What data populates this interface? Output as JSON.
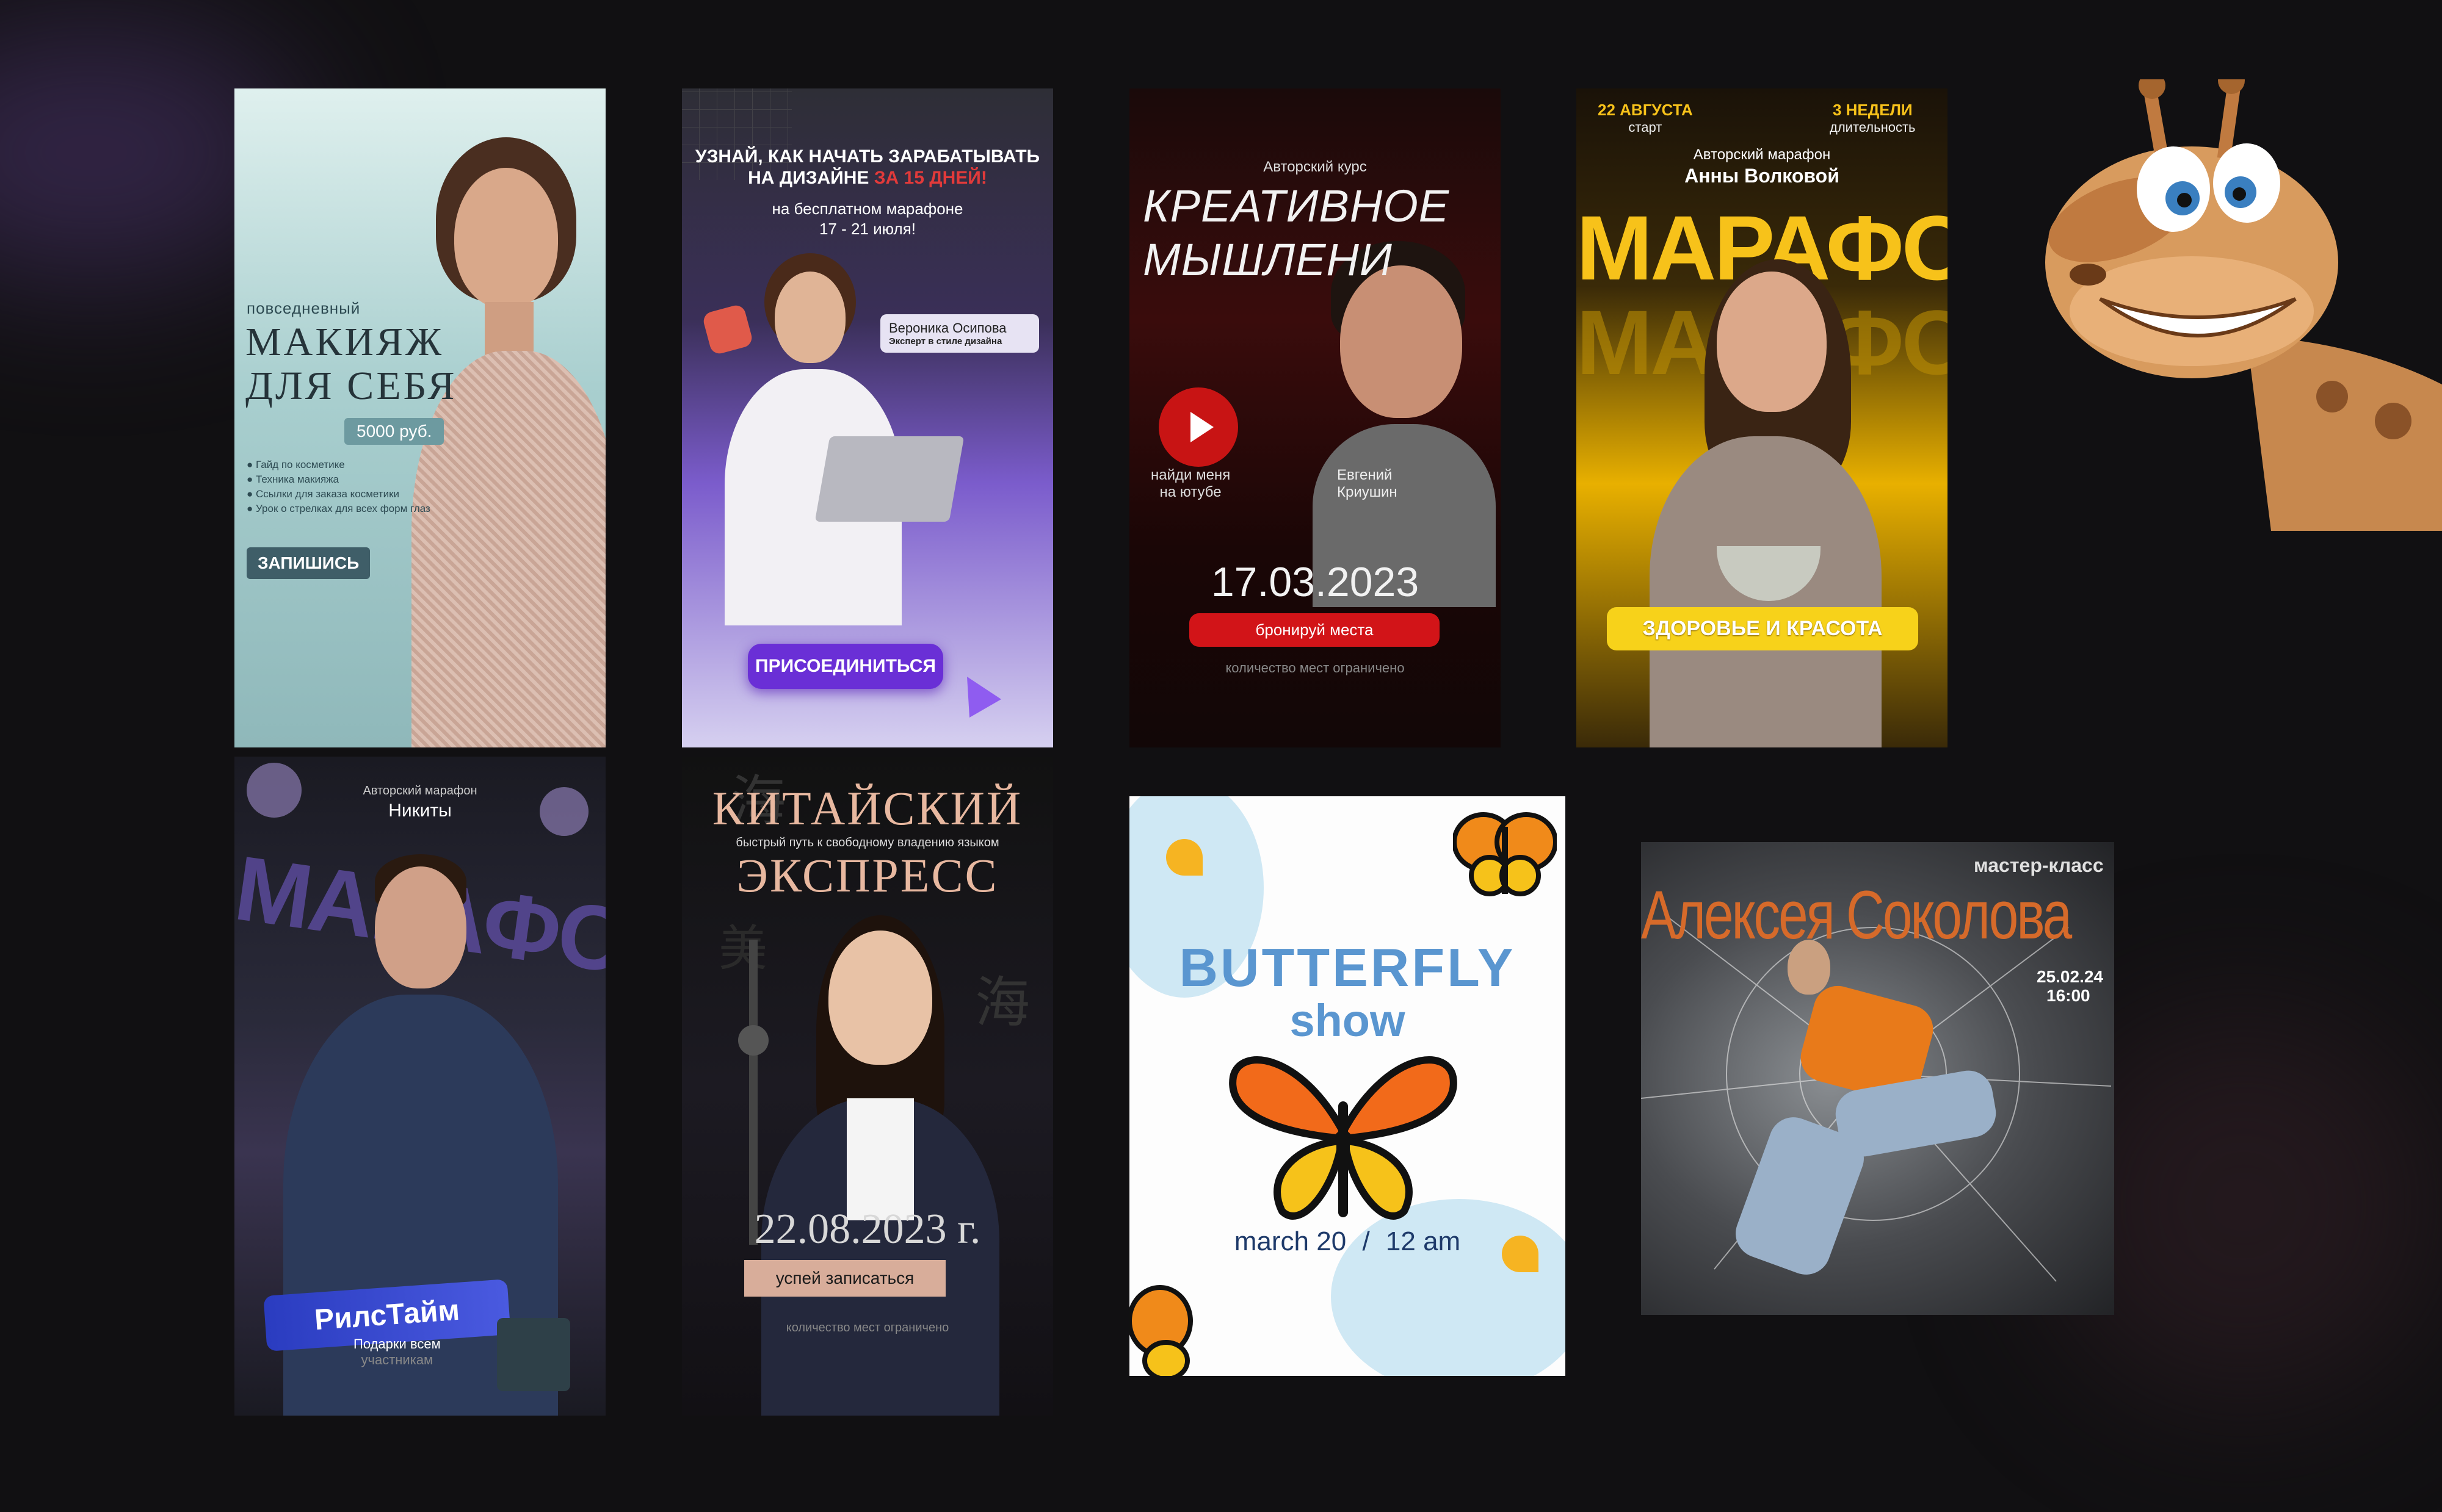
{
  "colors": {
    "background": "#111012",
    "accent_purple": "#6a2fd6",
    "accent_red": "#d21418",
    "accent_yellow": "#f7c21a"
  },
  "card1": {
    "subtitle": "повседневный",
    "title_line1": "МАКИЯЖ",
    "title_line2": "ДЛЯ СЕБЯ",
    "price": "5000 руб.",
    "bullets": [
      "Гайд по косметике",
      "Техника макияжа",
      "Ссылки для заказа косметики",
      "Урок о стрелках для всех форм глаз"
    ],
    "cta": "ЗАПИШИСЬ"
  },
  "card2": {
    "headline1": "УЗНАЙ, КАК НАЧАТЬ ЗАРАБАТЫВАТЬ",
    "headline2a": "НА ДИЗАЙНЕ",
    "headline2b": "ЗА 15 ДНЕЙ!",
    "line3": "на бесплатном марафоне",
    "line4": "17 - 21 июля!",
    "expert_name": "Вероника Осипова",
    "expert_role": "Эксперт в стиле дизайна",
    "cta": "ПРИСОЕДИНИТЬСЯ"
  },
  "card3": {
    "kicker": "Авторский курс",
    "title1": "КРЕАТИВНОЕ",
    "title2": "МЫШЛЕНИ",
    "youtube1": "найди меня",
    "youtube2": "на ютубе",
    "author1": "Евгений",
    "author2": "Криушин",
    "date": "17.03.2023",
    "cta": "бронируй места",
    "note": "количество мест ограничено"
  },
  "card4": {
    "date_top": "22 АВГУСТА",
    "date_sub": "старт",
    "dur_top": "3 НЕДЕЛИ",
    "dur_sub": "длительность",
    "kicker": "Авторский марафон",
    "author": "Анны Волковой",
    "big": "МАРАФОН",
    "badge": "ЗДОРОВЬЕ И КРАСОТА"
  },
  "card5": {
    "kicker": "Авторский марафон",
    "author": "Никиты",
    "big": "МАРАФОН",
    "badge": "РилсТайм",
    "gift1": "Подарки всем",
    "gift2": "участникам"
  },
  "card6": {
    "title1": "КИТАЙСКИЙ",
    "subtitle": "быстрый путь к свободному владению языком",
    "title2": "ЭКСПРЕСС",
    "date": "22.08.2023 г.",
    "cta": "успей записаться",
    "note": "количество мест ограничено",
    "glyph1": "海",
    "glyph2": "海",
    "glyph3": "美"
  },
  "card7": {
    "title1": "BUTTERFLY",
    "title2": "show",
    "date": "march 20",
    "sep": "/",
    "time": "12 am"
  },
  "card8": {
    "kicker": "мастер-класс",
    "name": "Алексея Соколова",
    "date": "25.02.24",
    "time": "16:00"
  }
}
